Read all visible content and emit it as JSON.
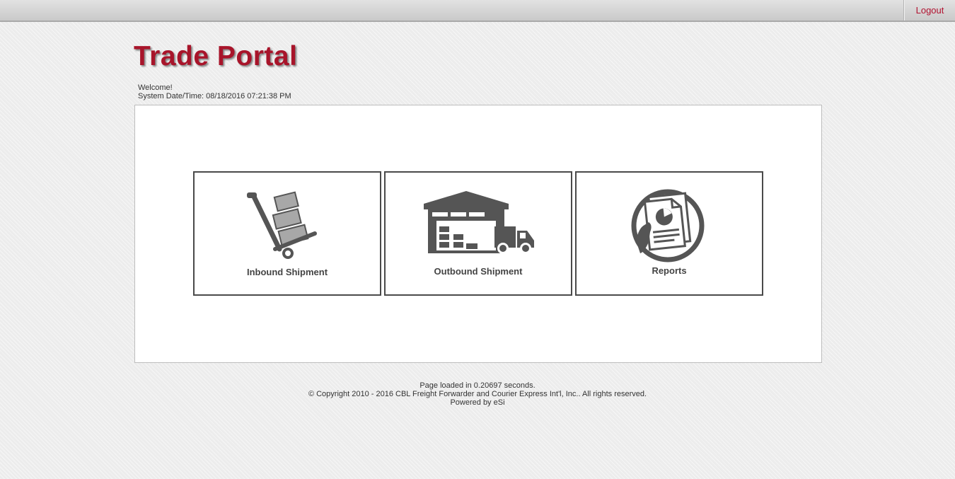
{
  "topbar": {
    "logout_label": "Logout"
  },
  "header": {
    "title": "Trade Portal"
  },
  "welcome": {
    "greeting": "Welcome!",
    "datetime": "System Date/Time: 08/18/2016 07:21:38 PM"
  },
  "tiles": [
    {
      "label": "Inbound Shipment",
      "icon": "hand-truck-icon"
    },
    {
      "label": "Outbound Shipment",
      "icon": "warehouse-truck-icon"
    },
    {
      "label": "Reports",
      "icon": "report-chart-icon"
    }
  ],
  "footer": {
    "load_time": "Page loaded in 0.20697 seconds.",
    "copyright": "© Copyright 2010 - 2016 CBL Freight Forwarder and Courier Express Int'l, Inc.. All rights reserved.",
    "powered_by": "Powered by eSi"
  },
  "colors": {
    "brand": "#a8142a",
    "logout": "#b1112f",
    "icon": "#555555",
    "tile_border": "#4a4a4a"
  }
}
